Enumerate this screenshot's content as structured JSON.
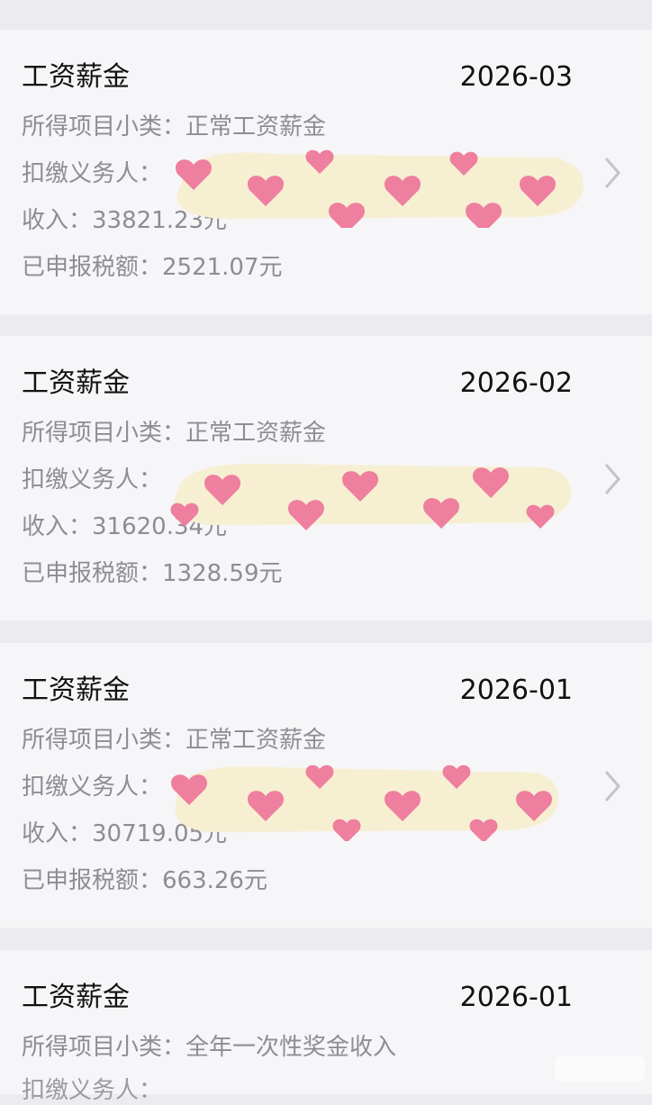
{
  "cards": [
    {
      "title": "工资薪金",
      "date": "2026-03",
      "subcategory": "所得项目小类：正常工资薪金",
      "withholder_label": "扣缴义务人：",
      "income": "收入：33821.23元",
      "tax": "已申报税额：2521.07元"
    },
    {
      "title": "工资薪金",
      "date": "2026-02",
      "subcategory": "所得项目小类：正常工资薪金",
      "withholder_label": "扣缴义务人：",
      "income": "收入：31620.34元",
      "tax": "已申报税额：1328.59元"
    },
    {
      "title": "工资薪金",
      "date": "2026-01",
      "subcategory": "所得项目小类：正常工资薪金",
      "withholder_label": "扣缴义务人：",
      "income": "收入：30719.05元",
      "tax": "已申报税额：663.26元"
    },
    {
      "title": "工资薪金",
      "date": "2026-01",
      "subcategory": "所得项目小类：全年一次性奖金收入",
      "withholder_label": "扣缴义务人："
    }
  ],
  "icons": {
    "chevron": "chevron-right-icon",
    "redaction": "heart-sticker-redaction"
  },
  "colors": {
    "page_bg": "#ececf0",
    "card_bg": "#f6f6f8",
    "title_text": "#111111",
    "secondary_text": "#8d8d93",
    "chevron": "#c4c4c8",
    "sticker_bg": "#f7efd2",
    "heart": "#ee7f9e"
  }
}
